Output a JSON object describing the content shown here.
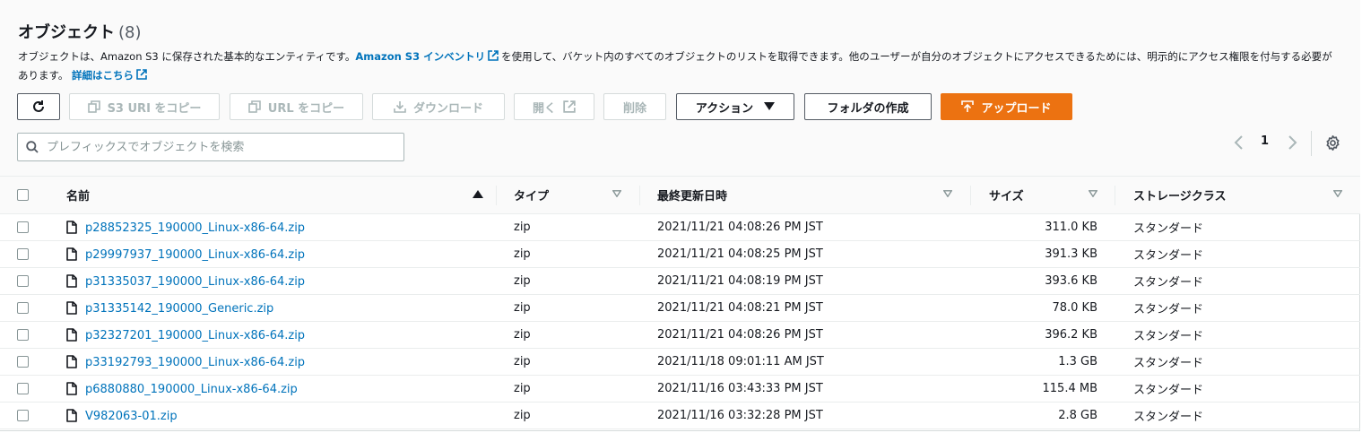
{
  "header": {
    "title": "オブジェクト",
    "count": "(8)",
    "desc": {
      "part1": "オブジェクトは、Amazon S3 に保存された基本的なエンティティです。",
      "inventory_link": "Amazon S3 インベントリ",
      "part2": "を使用して、バケット内のすべてのオブジェクトのリストを取得できます。他のユーザーが自分のオブジェクトにアクセスできるためには、明示的にアクセス権限を付与する必要があります。",
      "details_link": "詳細はこちら"
    }
  },
  "toolbar": {
    "refresh_icon": "refresh-icon",
    "copy_s3_uri": "S3 URI をコピー",
    "copy_url": "URL をコピー",
    "download": "ダウンロード",
    "open": "開く",
    "delete": "削除",
    "actions": "アクション",
    "create_folder": "フォルダの作成",
    "upload": "アップロード"
  },
  "search": {
    "placeholder": "プレフィックスでオブジェクトを検索"
  },
  "pagination": {
    "current_page": "1"
  },
  "table": {
    "columns": {
      "name": "名前",
      "type": "タイプ",
      "last_modified": "最終更新日時",
      "size": "サイズ",
      "storage_class": "ストレージクラス"
    },
    "rows": [
      {
        "name": "p28852325_190000_Linux-x86-64.zip",
        "type": "zip",
        "modified": "2021/11/21 04:08:26 PM JST",
        "size": "311.0 KB",
        "storage": "スタンダード"
      },
      {
        "name": "p29997937_190000_Linux-x86-64.zip",
        "type": "zip",
        "modified": "2021/11/21 04:08:25 PM JST",
        "size": "391.3 KB",
        "storage": "スタンダード"
      },
      {
        "name": "p31335037_190000_Linux-x86-64.zip",
        "type": "zip",
        "modified": "2021/11/21 04:08:19 PM JST",
        "size": "393.6 KB",
        "storage": "スタンダード"
      },
      {
        "name": "p31335142_190000_Generic.zip",
        "type": "zip",
        "modified": "2021/11/21 04:08:21 PM JST",
        "size": "78.0 KB",
        "storage": "スタンダード"
      },
      {
        "name": "p32327201_190000_Linux-x86-64.zip",
        "type": "zip",
        "modified": "2021/11/21 04:08:26 PM JST",
        "size": "396.2 KB",
        "storage": "スタンダード"
      },
      {
        "name": "p33192793_190000_Linux-x86-64.zip",
        "type": "zip",
        "modified": "2021/11/18 09:01:11 AM JST",
        "size": "1.3 GB",
        "storage": "スタンダード"
      },
      {
        "name": "p6880880_190000_Linux-x86-64.zip",
        "type": "zip",
        "modified": "2021/11/16 03:43:33 PM JST",
        "size": "115.4 MB",
        "storage": "スタンダード"
      },
      {
        "name": "V982063-01.zip",
        "type": "zip",
        "modified": "2021/11/16 03:32:28 PM JST",
        "size": "2.8 GB",
        "storage": "スタンダード"
      }
    ]
  },
  "colors": {
    "link": "#0073bb",
    "primary": "#ec7211",
    "disabled": "#aab7b8"
  }
}
